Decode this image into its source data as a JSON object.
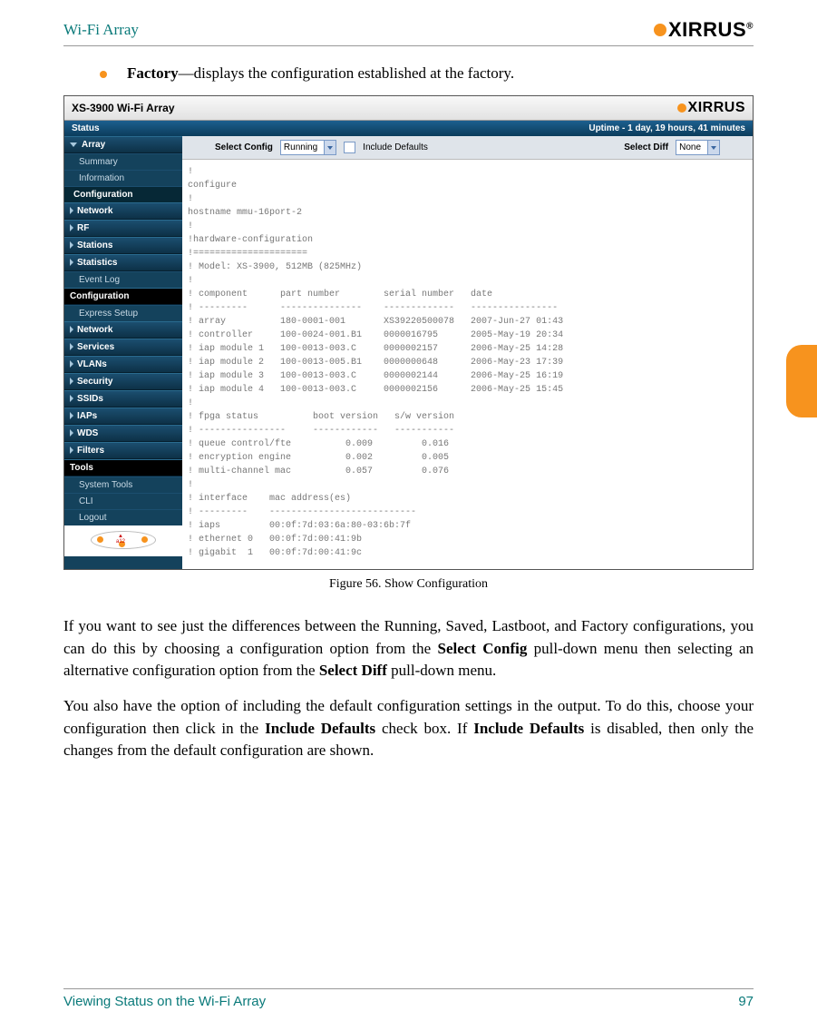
{
  "header": {
    "left": "Wi-Fi Array",
    "logo_text": "XIRRUS"
  },
  "bullet": {
    "bold": "Factory",
    "rest": "—displays the configuration established at the factory."
  },
  "screenshot": {
    "titlebar": "XS-3900 Wi-Fi Array",
    "status_left": "Status",
    "status_right": "Uptime - 1 day, 19 hours, 41 minutes",
    "sidebar": {
      "array": "Array",
      "summary": "Summary",
      "information": "Information",
      "configuration_group": "Configuration",
      "network": "Network",
      "rf": "RF",
      "stations": "Stations",
      "statistics": "Statistics",
      "event_log": "Event Log",
      "config_section": "Configuration",
      "express": "Express Setup",
      "network2": "Network",
      "services": "Services",
      "vlans": "VLANs",
      "security": "Security",
      "ssids": "SSIDs",
      "iaps": "IAPs",
      "wds": "WDS",
      "filters": "Filters",
      "tools": "Tools",
      "system_tools": "System Tools",
      "cli": "CLI",
      "logout": "Logout"
    },
    "toolbar": {
      "select_config": "Select Config",
      "running": "Running",
      "include_defaults": "Include Defaults",
      "select_diff": "Select Diff",
      "none": "None"
    },
    "config_text": "!\nconfigure\n!\nhostname mmu-16port-2\n!\n!hardware-configuration\n!=====================\n! Model: XS-3900, 512MB (825MHz)\n!\n! component      part number        serial number   date\n! ---------      ---------------    -------------   ----------------\n! array          180-0001-001       XS39220500078   2007-Jun-27 01:43\n! controller     100-0024-001.B1    0000016795      2005-May-19 20:34\n! iap module 1   100-0013-003.C     0000002157      2006-May-25 14:28\n! iap module 2   100-0013-005.B1    0000000648      2006-May-23 17:39\n! iap module 3   100-0013-003.C     0000002144      2006-May-25 16:19\n! iap module 4   100-0013-003.C     0000002156      2006-May-25 15:45\n!\n! fpga status          boot version   s/w version\n! ----------------     ------------   -----------\n! queue control/fte          0.009         0.016\n! encryption engine          0.002         0.005\n! multi-channel mac          0.057         0.076\n!\n! interface    mac address(es)\n! ---------    ---------------------------\n! iaps         00:0f:7d:03:6a:80-03:6b:7f\n! ethernet 0   00:0f:7d:00:41:9b\n! gigabit  1   00:0f:7d:00:41:9c"
  },
  "caption": "Figure 56. Show Configuration",
  "para1_a": "If you want to see just the differences between the Running, Saved, Lastboot, and Factory configurations, you can do this by choosing a configuration option from the ",
  "para1_b": "Select Config",
  "para1_c": " pull-down menu then selecting an alternative configuration option from the ",
  "para1_d": "Select Diff",
  "para1_e": " pull-down menu.",
  "para2_a": "You also have the option of including the default configuration settings in the output. To do this, choose your configuration then click in the ",
  "para2_b": "Include Defaults",
  "para2_c": " check box. If ",
  "para2_d": "Include Defaults",
  "para2_e": " is disabled, then only the changes from the default configuration are shown.",
  "footer": {
    "left": "Viewing Status on the Wi-Fi Array",
    "right": "97"
  }
}
